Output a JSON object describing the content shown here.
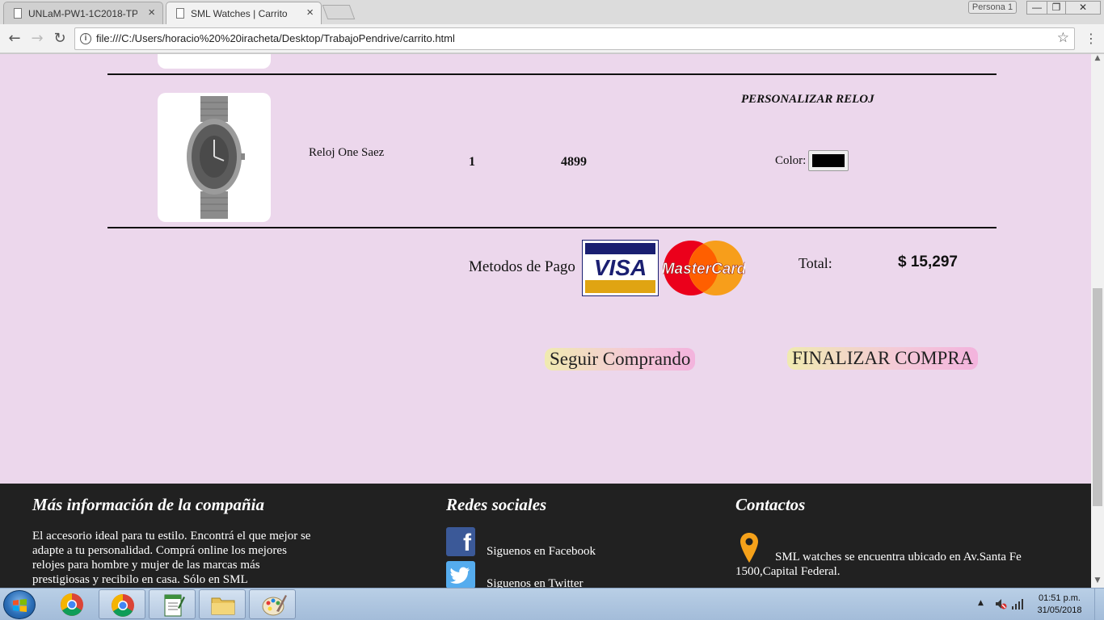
{
  "browser": {
    "tabs": [
      {
        "title": "UNLaM-PW1-1C2018-TP",
        "close": "×"
      },
      {
        "title": "SML Watches | Carrito",
        "close": "×"
      }
    ],
    "profile": "Persona 1",
    "window_controls": {
      "minimize": "—",
      "restore": "❐",
      "close": "✕"
    },
    "url": "file:///C:/Users/horacio%20%20iracheta/Desktop/TrabajoPendrive/carrito.html",
    "icons": {
      "back": "arrow-left-icon",
      "forward": "arrow-right-icon",
      "reload": "reload-icon",
      "info": "info-icon",
      "bookmark": "star-icon",
      "menu": "kebab-menu-icon"
    }
  },
  "cart": {
    "item": {
      "name": "Reloj One Saez",
      "quantity": "1",
      "price": "4899",
      "personalize_title": "PERSONALIZAR RELOJ",
      "color_label": "Color:",
      "color_value": "#000000"
    },
    "payment_label": "Metodos de Pago",
    "payment_methods": [
      "VISA",
      "MasterCard"
    ],
    "total_label": "Total:",
    "total_value": "$ 15,297",
    "continue_button": "Seguir Comprando",
    "checkout_button": "FINALIZAR COMPRA"
  },
  "footer": {
    "company_title": "Más información de la compañia",
    "company_text": "El accesorio ideal para tu estilo. Encontrá el que mejor se adapte a tu personalidad. Comprá online los mejores relojes para hombre y mujer de las marcas más prestigiosas y recibilo en casa. Sólo en SML",
    "social_title": "Redes sociales",
    "facebook_label": "Siguenos en Facebook",
    "twitter_label": "Siguenos en Twitter",
    "contact_title": "Contactos",
    "contact_text": "SML watches se encuentra ubicado en Av.Santa Fe 1500,Capital Federal."
  },
  "taskbar": {
    "time": "01:51 p.m.",
    "date": "31/05/2018",
    "apps": [
      "chrome",
      "chrome-active",
      "notepad",
      "file-explorer",
      "paint"
    ]
  },
  "colors": {
    "page_bg": "#ecd7ec",
    "footer_bg": "#212121",
    "visa_blue": "#1a1f71",
    "visa_gold": "#e0a412",
    "mc_red": "#eb001b",
    "mc_orange": "#f79e1b"
  }
}
